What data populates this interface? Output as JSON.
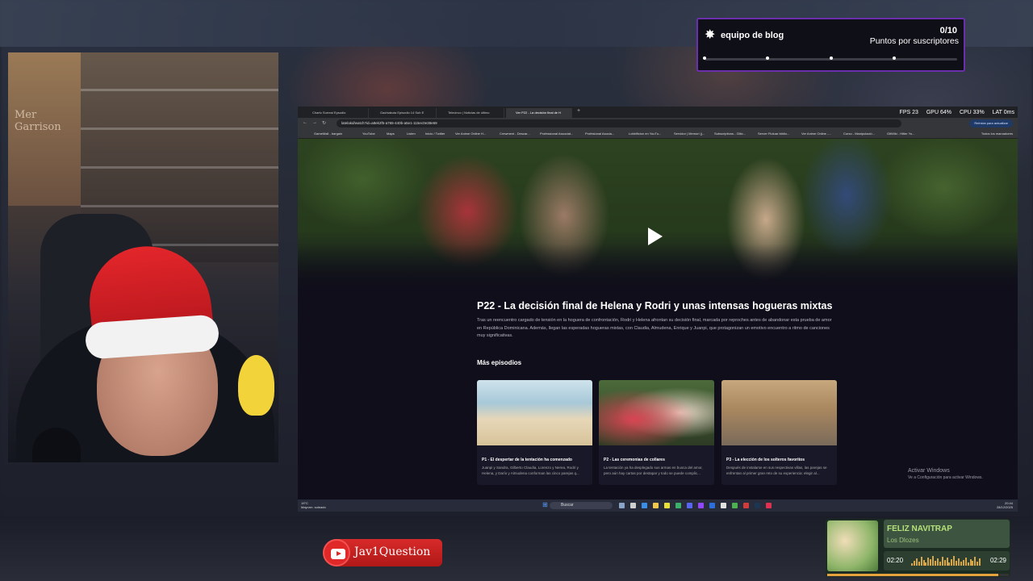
{
  "goal": {
    "title": "equipo de blog",
    "count": "0/10",
    "subtitle": "Puntos por suscriptores",
    "progress": 0
  },
  "webcam": {
    "poster_text": "Mer Garrison"
  },
  "browser": {
    "tabs": [
      "Charlo Surreal Epsodio",
      "Gachiakuta Episodio 14 Sub E",
      "Telecinco | Noticias de último",
      "Ver P22 - La decisión final de H"
    ],
    "stats": {
      "fps": "FPS 23",
      "gpu": "GPU 64%",
      "cpu": "CPU 33%",
      "lat": "LAT 0ms"
    },
    "url": "latelakd/watch?id=a8ek2f5-a765-440b-a5e1-115ec0e38e69",
    "update_label": "Reinicia para actualizar",
    "bookmarks": [
      "GameMall - bargain",
      "YouTube",
      "Maps",
      "Listen",
      "Inicio / Twitter",
      "Ver Anime Online H...",
      "Crewment - Descar...",
      "Professional Associat...",
      "Profesional Asocia...",
      "Lobbificion en YouTu...",
      "Servidor | Memori (j...",
      "Subscriptions - Glitc...",
      "Server Flutuar biblio...",
      "Ver Anime Online -...",
      "Curso - Manipulació...",
      "GitWiki - Hitler Yo..."
    ],
    "bookmarks_all": "Todos los marcadores",
    "episode": {
      "title": "P22 - La decisión final de Helena y Rodri y unas intensas hogueras mixtas",
      "description": "Tras un reencuentro cargado de tensión en la hoguera de confrontación, Rodri y Helena afrontan su decisión final, marcada por reproches antes de abandonar esta prueba de amor en República Dominicana. Además, llegan las esperadas hogueras mixtas, con Claudia, Almudena, Enrique y Juanpi, que protagonizan un emotivo encuentro a ritmo de canciones muy significativas."
    },
    "more_title": "Más episodios",
    "cards": [
      {
        "title": "P1 - El despertar de la tentación ha comenzado",
        "desc": "Juanpi y Sandra, Gilberto Claudia, Lorenzo y Nerea, Rodri y Helena, y Darío y Almudena conforman las cinco parejas q..."
      },
      {
        "title": "P2 - Las ceremonias de collares",
        "desc": "La tentación ya ha desplegado sus armas en busca del amor, pero aún hay cartas por destapar y todo se puede complic..."
      },
      {
        "title": "P3 - La elección de los solteros favoritos",
        "desc": "Después de instalarse en sus respectivas villas, las parejas se enfrentan al primer gran reto de su experiencia: elegir al..."
      }
    ],
    "activate": "Activar Windows",
    "activate_sub": "Ve a Configuración para activar Windows.",
    "taskbar": {
      "weather_temp": "19°C",
      "weather_desc": "Mayorm. soleado",
      "search": "Buscar",
      "time": "20:44",
      "date": "28/12/2025"
    }
  },
  "youtube_badge": {
    "name": "Jav1Question"
  },
  "player": {
    "song": "FELIZ NAVITRAP",
    "artist": "Los Dlozes",
    "current": "02:20",
    "total": "02:29",
    "progress": 0.94
  },
  "colors": {
    "goal_border": "#6b2fae",
    "player_accent": "#b6e07a",
    "youtube_red": "#d82a2a"
  }
}
